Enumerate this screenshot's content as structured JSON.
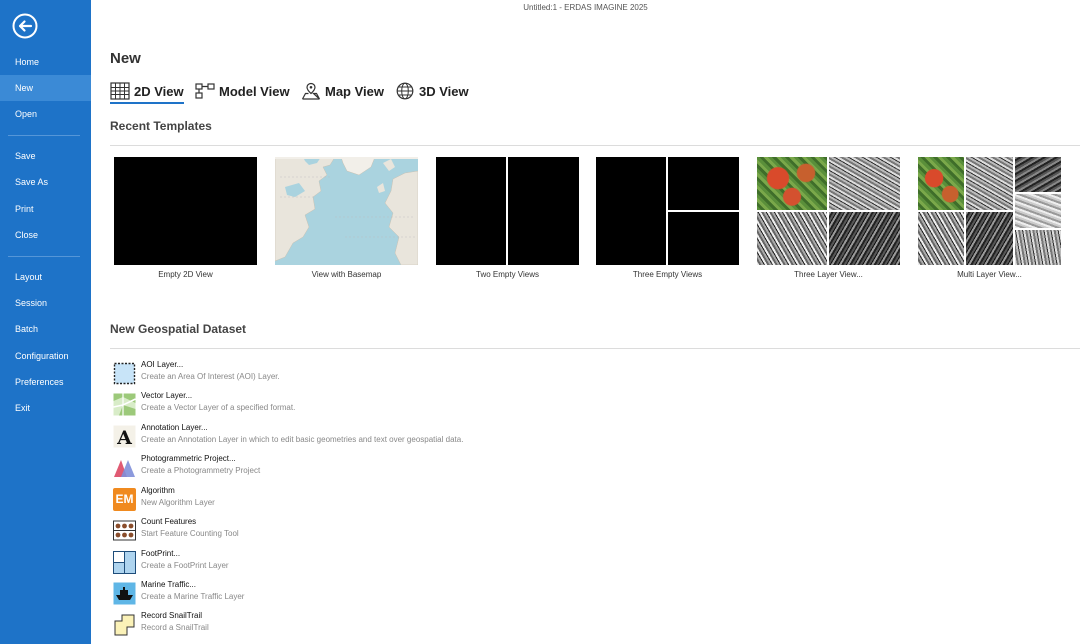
{
  "window": {
    "title": "Untitled:1 -  ERDAS IMAGINE 2025"
  },
  "sidebar": {
    "items": [
      {
        "label": "Home"
      },
      {
        "label": "New"
      },
      {
        "label": "Open"
      },
      {
        "label": "Save"
      },
      {
        "label": "Save As"
      },
      {
        "label": "Print"
      },
      {
        "label": "Close"
      },
      {
        "label": "Layout"
      },
      {
        "label": "Session"
      },
      {
        "label": "Batch"
      },
      {
        "label": "Configuration"
      },
      {
        "label": "Preferences"
      },
      {
        "label": "Exit"
      }
    ],
    "active": "New"
  },
  "main": {
    "title": "New",
    "view_tabs": [
      {
        "label": "2D View",
        "icon": "grid-icon"
      },
      {
        "label": "Model View",
        "icon": "flowchart-icon"
      },
      {
        "label": "Map View",
        "icon": "map-pin-icon"
      },
      {
        "label": "3D View",
        "icon": "globe-icon"
      }
    ],
    "recent_templates_title": "Recent Templates",
    "templates": [
      {
        "label": "Empty 2D View"
      },
      {
        "label": "View with Basemap"
      },
      {
        "label": "Two Empty Views"
      },
      {
        "label": "Three Empty Views"
      },
      {
        "label": "Three Layer View..."
      },
      {
        "label": "Multi Layer View..."
      }
    ],
    "dataset_title": "New Geospatial Dataset",
    "datasets": [
      {
        "title": "AOI Layer...",
        "desc": "Create an Area Of Interest (AOI) Layer.",
        "icon": "aoi-icon"
      },
      {
        "title": "Vector Layer...",
        "desc": "Create a Vector Layer of a specified format.",
        "icon": "vector-icon"
      },
      {
        "title": "Annotation Layer...",
        "desc": "Create an Annotation Layer in which to edit basic geometries and text over geospatial data.",
        "icon": "annotation-icon"
      },
      {
        "title": "Photogrammetric Project...",
        "desc": "Create a Photogrammetry Project",
        "icon": "photogrammetry-icon"
      },
      {
        "title": "Algorithm",
        "desc": "New Algorithm Layer",
        "icon": "algorithm-icon",
        "icon_text": "EM"
      },
      {
        "title": "Count Features",
        "desc": "Start Feature Counting Tool",
        "icon": "count-icon"
      },
      {
        "title": "FootPrint...",
        "desc": "Create a FootPrint Layer",
        "icon": "footprint-icon"
      },
      {
        "title": "Marine Traffic...",
        "desc": "Create a Marine Traffic Layer",
        "icon": "ship-icon"
      },
      {
        "title": "Record SnailTrail",
        "desc": "Record a SnailTrail",
        "icon": "snailtrail-icon"
      }
    ]
  },
  "colors": {
    "sidebar": "#1e73c8",
    "sidebar_active": "#3b8ad6",
    "accent": "#1e73c8"
  }
}
